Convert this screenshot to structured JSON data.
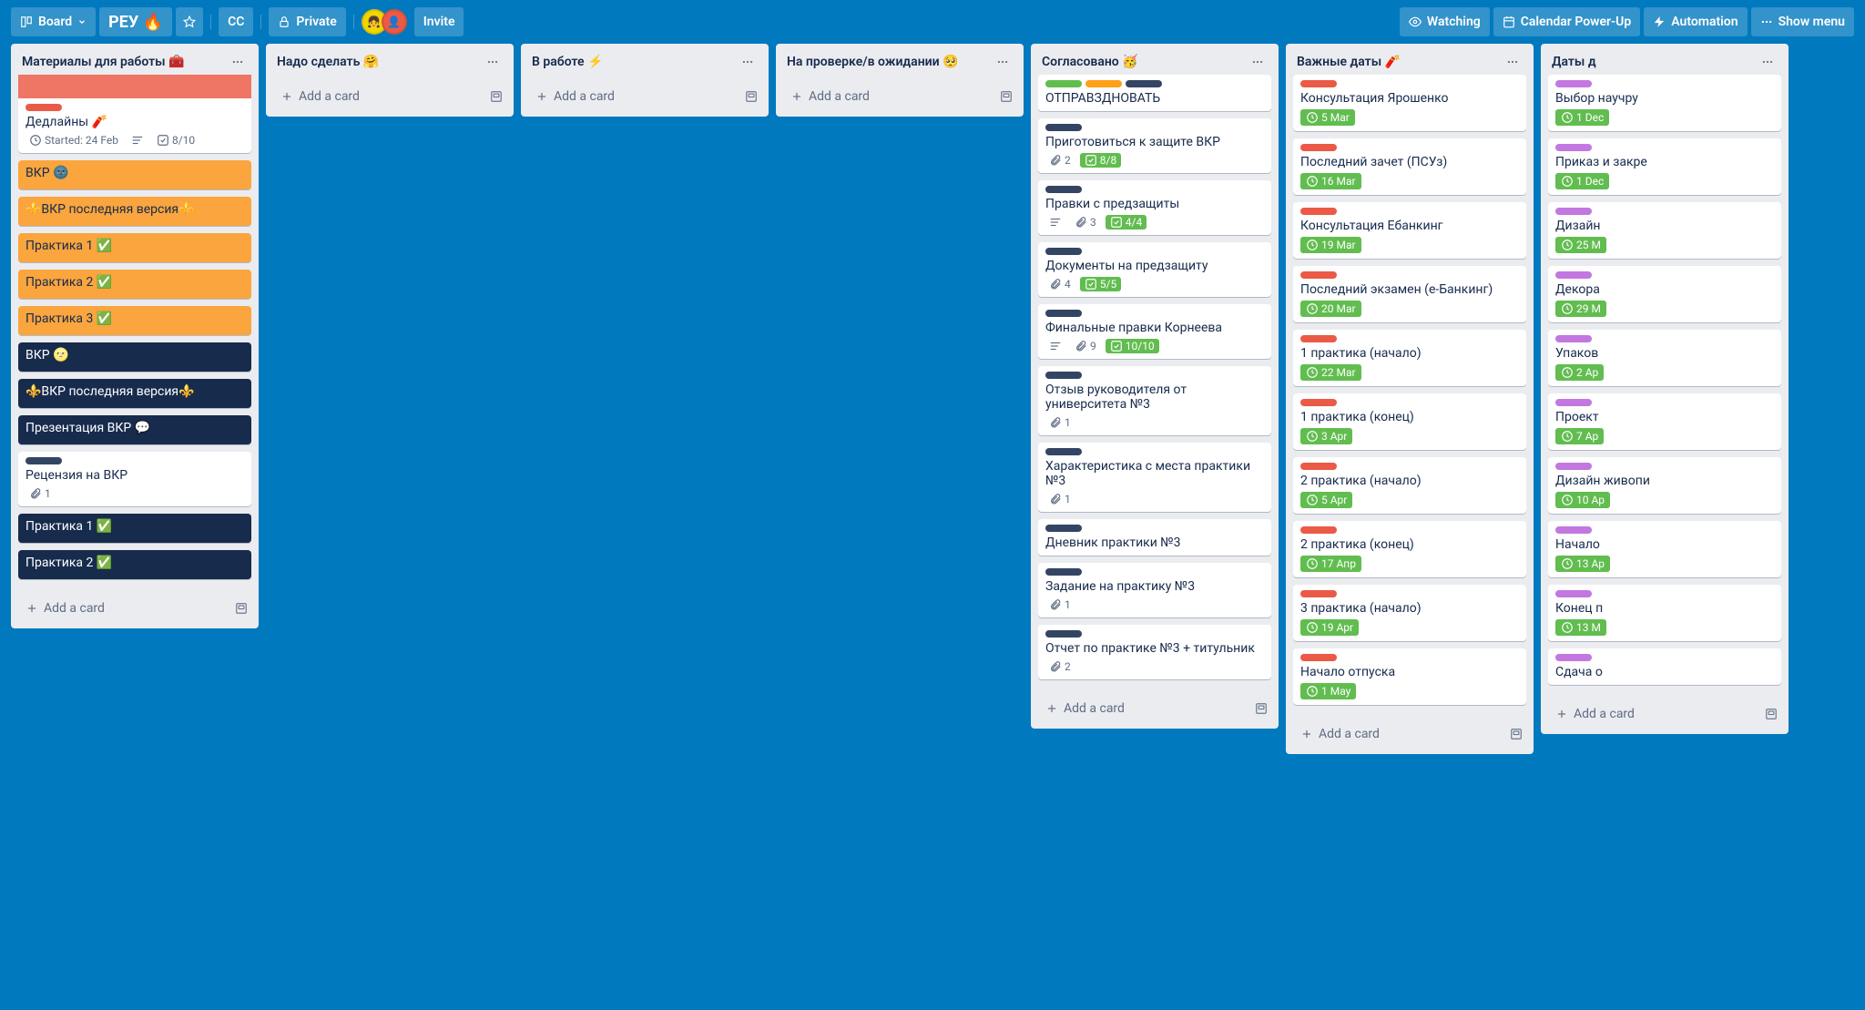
{
  "header": {
    "view_label": "Board",
    "title": "РЕУ 🔥",
    "workspace": "CC",
    "visibility": "Private",
    "invite": "Invite",
    "watching": "Watching",
    "calendar": "Calendar Power-Up",
    "automation": "Automation",
    "menu": "Show menu"
  },
  "add_card_label": "Add a card",
  "lists": [
    {
      "title": "Материалы для работы 🧰",
      "cards": [
        {
          "cover": "coral",
          "labels": [
            "red"
          ],
          "title": "Дедлайны 🧨",
          "badges": {
            "start": "Started: 24 Feb",
            "desc": true,
            "check": "8/10"
          }
        },
        {
          "style": "orange",
          "title": "ВКР 🌚"
        },
        {
          "style": "orange",
          "title": "⚜️ВКР последняя версия⚜️"
        },
        {
          "style": "orange",
          "title": "Практика 1 ✅"
        },
        {
          "style": "orange",
          "title": "Практика 2 ✅"
        },
        {
          "style": "orange",
          "title": "Практика 3 ✅"
        },
        {
          "style": "navy",
          "title": "ВКР 🌝"
        },
        {
          "style": "navy",
          "title": "⚜️ВКР последняя версия⚜️"
        },
        {
          "style": "navy",
          "title": "Презентация ВКР 💬"
        },
        {
          "labels": [
            "navy"
          ],
          "title": "Рецензия на ВКР",
          "badges": {
            "attach": "1"
          }
        },
        {
          "style": "navy",
          "title": "Практика 1 ✅"
        },
        {
          "style": "navy",
          "title": "Практика 2 ✅"
        }
      ]
    },
    {
      "title": "Надо сделать 🤗",
      "cards": []
    },
    {
      "title": "В работе ⚡️",
      "cards": []
    },
    {
      "title": "На проверке/в ожидании 🥺",
      "cards": []
    },
    {
      "title": "Согласовано 🥳",
      "cards": [
        {
          "labels": [
            "green",
            "orange",
            "navy"
          ],
          "title": "ОТПРАВЗДНОВАТЬ"
        },
        {
          "labels": [
            "navy"
          ],
          "title": "Приготовиться к защите ВКР",
          "badges": {
            "attach": "2",
            "check_done": "8/8"
          }
        },
        {
          "labels": [
            "navy"
          ],
          "title": "Правки с предзащиты",
          "badges": {
            "desc": true,
            "attach": "3",
            "check_done": "4/4"
          }
        },
        {
          "labels": [
            "navy"
          ],
          "title": "Документы на предзащиту",
          "badges": {
            "attach": "4",
            "check_done": "5/5"
          }
        },
        {
          "labels": [
            "navy"
          ],
          "title": "Финальные правки Корнеева",
          "badges": {
            "desc": true,
            "attach": "9",
            "check_done": "10/10"
          }
        },
        {
          "labels": [
            "navy"
          ],
          "title": "Отзыв руководителя от университета №3",
          "badges": {
            "attach": "1"
          }
        },
        {
          "labels": [
            "navy"
          ],
          "title": "Характеристика с места практики №3",
          "badges": {
            "attach": "1"
          }
        },
        {
          "labels": [
            "navy"
          ],
          "title": "Дневник практики №3"
        },
        {
          "labels": [
            "navy"
          ],
          "title": "Задание на практику №3",
          "badges": {
            "attach": "1"
          }
        },
        {
          "labels": [
            "navy"
          ],
          "title": "Отчет по практике №3 + титульник",
          "badges": {
            "attach": "2"
          }
        }
      ]
    },
    {
      "title": "Важные даты 🧨",
      "cards": [
        {
          "labels": [
            "red"
          ],
          "title": "Консультация Ярошенко",
          "badges": {
            "due": "5 Mar"
          }
        },
        {
          "labels": [
            "red"
          ],
          "title": "Последний зачет (ПСУз)",
          "badges": {
            "due": "16 Mar"
          }
        },
        {
          "labels": [
            "red"
          ],
          "title": "Консультация Ебанкинг",
          "badges": {
            "due": "19 Mar"
          }
        },
        {
          "labels": [
            "red"
          ],
          "title": "Последний экзамен (е-Банкинг)",
          "badges": {
            "due": "20 Mar"
          }
        },
        {
          "labels": [
            "red"
          ],
          "title": "1 практика (начало)",
          "badges": {
            "due": "22 Mar"
          }
        },
        {
          "labels": [
            "red"
          ],
          "title": "1 практика (конец)",
          "badges": {
            "due": "3 Apr"
          }
        },
        {
          "labels": [
            "red"
          ],
          "title": "2 практика (начало)",
          "badges": {
            "due": "5 Apr"
          }
        },
        {
          "labels": [
            "red"
          ],
          "title": "2 практика (конец)",
          "badges": {
            "due": "17 Апр"
          }
        },
        {
          "labels": [
            "red"
          ],
          "title": "3 практика (начало)",
          "badges": {
            "due": "19 Apr"
          }
        },
        {
          "labels": [
            "red"
          ],
          "title": "Начало отпуска",
          "badges": {
            "due": "1 May"
          }
        }
      ]
    },
    {
      "title": "Даты д",
      "cards": [
        {
          "labels": [
            "purple"
          ],
          "title": "Выбор научру",
          "badges": {
            "due": "1 Dec"
          }
        },
        {
          "labels": [
            "purple"
          ],
          "title": "Приказ и закре",
          "badges": {
            "due": "1 Dec"
          }
        },
        {
          "labels": [
            "purple"
          ],
          "title": "Дизайн",
          "badges": {
            "due": "25 M"
          }
        },
        {
          "labels": [
            "purple"
          ],
          "title": "Декора",
          "badges": {
            "due": "29 M"
          }
        },
        {
          "labels": [
            "purple"
          ],
          "title": "Упаков",
          "badges": {
            "due": "2 Ap"
          }
        },
        {
          "labels": [
            "purple"
          ],
          "title": "Проект",
          "badges": {
            "due": "7 Ap"
          }
        },
        {
          "labels": [
            "purple"
          ],
          "title": "Дизайн живопи",
          "badges": {
            "due": "10 Ap"
          }
        },
        {
          "labels": [
            "purple"
          ],
          "title": "Начало",
          "badges": {
            "due": "13 Ap"
          }
        },
        {
          "labels": [
            "purple"
          ],
          "title": "Конец п",
          "badges": {
            "due": "13 M"
          }
        },
        {
          "labels": [
            "purple"
          ],
          "title": "Сдача о"
        }
      ]
    }
  ]
}
